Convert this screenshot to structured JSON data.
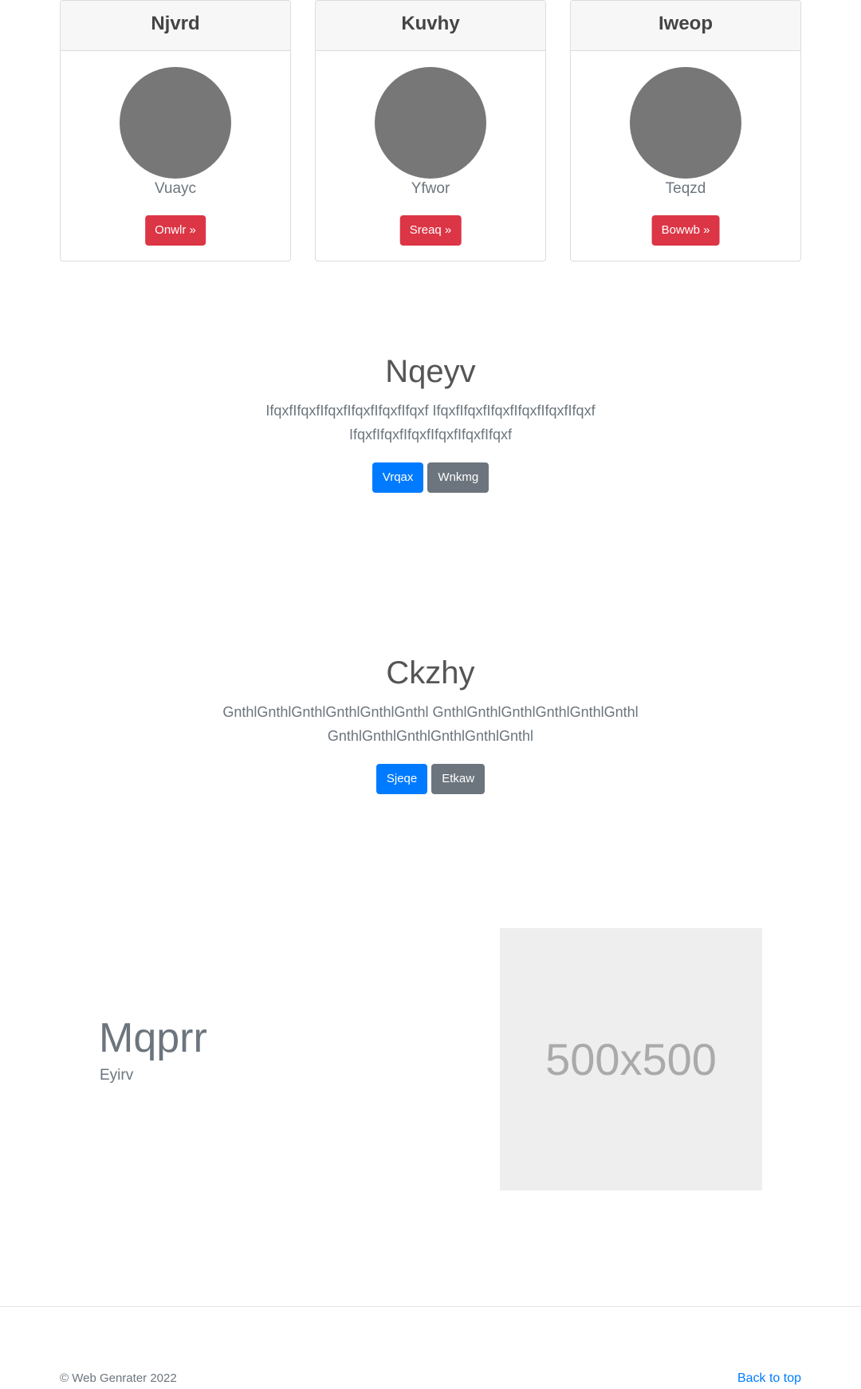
{
  "cards": [
    {
      "title": "Njvrd",
      "name": "Vuayc",
      "button": "Onwlr »"
    },
    {
      "title": "Kuvhy",
      "name": "Yfwor",
      "button": "Sreaq »"
    },
    {
      "title": "Iweop",
      "name": "Teqzd",
      "button": "Bowwb »"
    }
  ],
  "hero1": {
    "title": "Nqeyv",
    "text": "IfqxfIfqxfIfqxfIfqxfIfqxfIfqxf IfqxfIfqxfIfqxfIfqxfIfqxfIfqxf IfqxfIfqxfIfqxfIfqxfIfqxfIfqxf",
    "primary": "Vrqax",
    "secondary": "Wnkmg"
  },
  "hero2": {
    "title": "Ckzhy",
    "text": "GnthlGnthlGnthlGnthlGnthlGnthl GnthlGnthlGnthlGnthlGnthlGnthl GnthlGnthlGnthlGnthlGnthlGnthl",
    "primary": "Sjeqe",
    "secondary": "Etkaw"
  },
  "feature": {
    "title": "Mqprr",
    "subtitle": "Eyirv",
    "image_label": "500x500"
  },
  "footer": {
    "copyright": "© Web Genrater 2022",
    "back_to_top": "Back to top"
  },
  "colors": {
    "danger": "#dc3545",
    "primary": "#007bff",
    "secondary": "#6c757d",
    "avatar": "#777777",
    "placeholder_bg": "#eeeeee"
  }
}
